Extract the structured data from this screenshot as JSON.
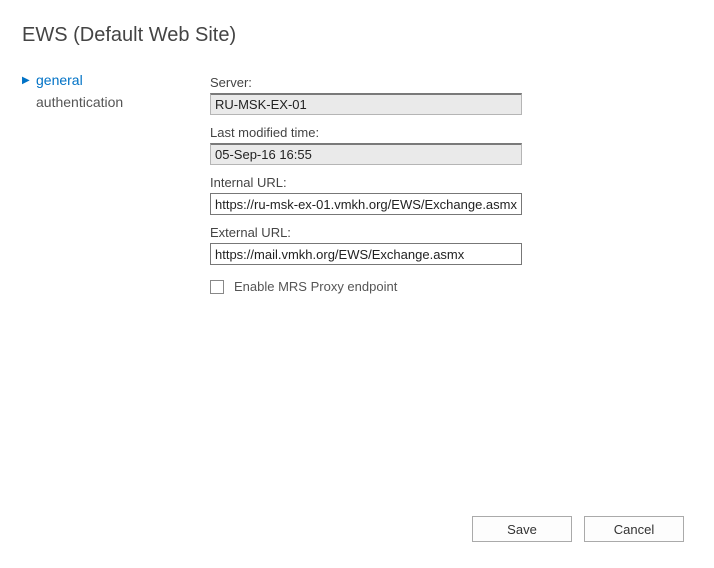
{
  "title": "EWS (Default Web Site)",
  "sidebar": {
    "items": [
      {
        "label": "general",
        "active": true
      },
      {
        "label": "authentication",
        "active": false
      }
    ]
  },
  "form": {
    "server": {
      "label": "Server:",
      "value": "RU-MSK-EX-01"
    },
    "modified": {
      "label": "Last modified time:",
      "value": "05-Sep-16 16:55"
    },
    "internal_url": {
      "label": "Internal URL:",
      "value": "https://ru-msk-ex-01.vmkh.org/EWS/Exchange.asmx"
    },
    "external_url": {
      "label": "External URL:",
      "value": "https://mail.vmkh.org/EWS/Exchange.asmx"
    },
    "mrs_proxy": {
      "label": "Enable MRS Proxy endpoint",
      "checked": false
    }
  },
  "footer": {
    "save_label": "Save",
    "cancel_label": "Cancel"
  }
}
